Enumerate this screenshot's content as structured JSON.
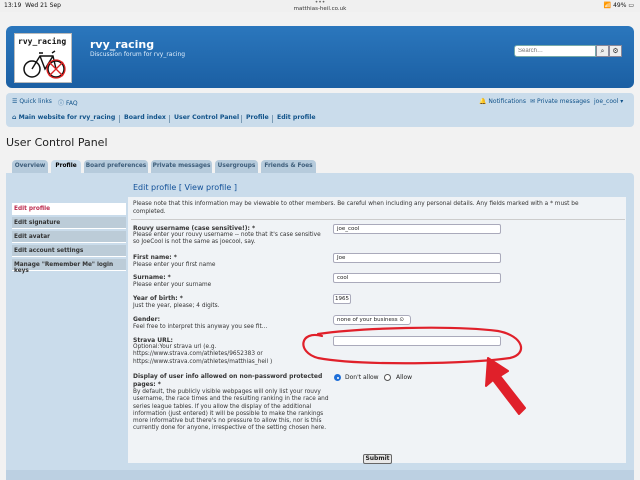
{
  "status": {
    "time": "13:19",
    "date": "Wed 21 Sep",
    "url": "matthias-heil.co.uk",
    "dots": "•••",
    "battery": "49%"
  },
  "site": {
    "logo_text": "rvy_racing",
    "title": "rvy_racing",
    "description": "Discussion forum for rvy_racing"
  },
  "search": {
    "placeholder": "Search…",
    "search_icon": "search-icon",
    "gear_icon": "gear-icon"
  },
  "nav": {
    "quick_links": "Quick links",
    "faq": "FAQ",
    "notifications": "Notifications",
    "private_messages": "Private messages",
    "user": "joe_cool",
    "breadcrumbs": [
      "Main website for rvy_racing",
      "Board index",
      "User Control Panel",
      "Profile",
      "Edit profile"
    ]
  },
  "page": {
    "title": "User Control Panel"
  },
  "tabs": [
    "Overview",
    "Profile",
    "Board preferences",
    "Private messages",
    "Usergroups",
    "Friends & Foes"
  ],
  "sidebar": [
    "Edit profile",
    "Edit signature",
    "Edit avatar",
    "Edit account settings",
    "Manage \"Remember Me\" login keys"
  ],
  "form": {
    "heading": "Edit profile",
    "view_profile": "View profile",
    "notice": "Please note that this information may be viewable to other members. Be careful when including any personal details. Any fields marked with a * must be completed.",
    "username": {
      "label": "Rouvy username (case sensitive!): *",
      "help": "Please enter your rouvy username -- note that it's case sensitive so JoeCool is not the same as joecool, say.",
      "value": "joe_cool"
    },
    "first_name": {
      "label": "First name: *",
      "help": "Please enter your first name",
      "value": "Joe"
    },
    "surname": {
      "label": "Surname: *",
      "help": "Please enter your surname",
      "value": "cool"
    },
    "year_of_birth": {
      "label": "Year of birth: *",
      "help": "Just the year, please; 4 digits.",
      "value": "1965"
    },
    "gender": {
      "label": "Gender:",
      "help": "Feel free to interpret this anyway you see fit...",
      "value": "none of your business"
    },
    "strava": {
      "label": "Strava URL:",
      "help": "Optional:Your strava url (e.g. https://www.strava.com/athletes/9652383 or https://www.strava.com/athletes/matthias_heil )",
      "value": ""
    },
    "display": {
      "label": "Display of user info allowed on non-password protected pages: *",
      "help": "By default, the publicly visible webpages will only list your rouvy username, the race times and the resulting ranking in the race and series league tables. If you allow the display of the additional information (just entered) it will be possible to make the rankings more informative but there's no pressure to allow this, nor is this currently done for anyone, irrespective of the setting chosen here.",
      "options": [
        "Don't allow",
        "Allow"
      ],
      "selected": "Don't allow"
    },
    "submit": "Submit"
  },
  "annotation_color": "#e0202a"
}
